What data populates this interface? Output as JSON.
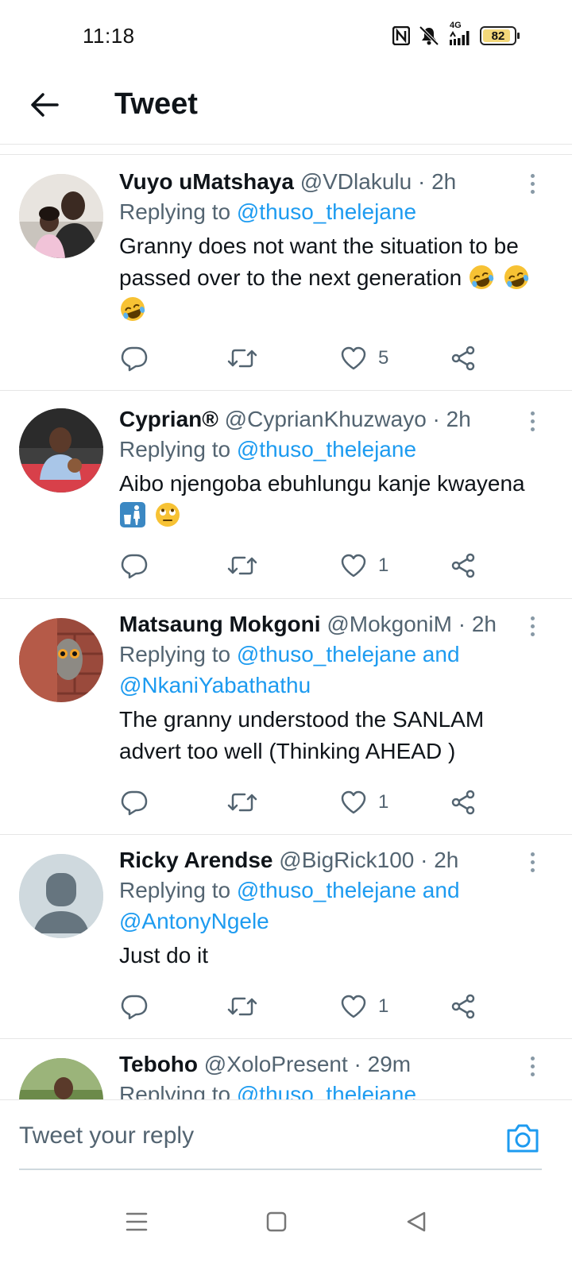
{
  "status_bar": {
    "time": "11:18",
    "network": "4G",
    "battery": "82",
    "battery_level": 0.82,
    "icons": [
      "nfc-icon",
      "mute-icon",
      "signal-icon",
      "battery-icon"
    ]
  },
  "header": {
    "title": "Tweet",
    "back_icon": "arrow-left-icon"
  },
  "tweets": [
    {
      "name": "Vuyo uMatshaya",
      "handle": "@VDlakulu",
      "separator": "·",
      "time": "2h",
      "reply_prefix": "Replying to",
      "reply_to": "@thuso_thelejane",
      "text": "Granny does not want the situation to be passed over to the next generation",
      "emojis": [
        "rofl",
        "rofl",
        "rofl"
      ],
      "likes": "5"
    },
    {
      "name": "Cyprian®",
      "handle": "@CyprianKhuzwayo",
      "separator": "·",
      "time": "2h",
      "reply_prefix": "Replying to",
      "reply_to": "@thuso_thelejane",
      "text": "Aibo njengoba ebuhlungu kanje kwayena",
      "emojis": [
        "litter-bin-sign",
        "eye-roll"
      ],
      "likes": "1"
    },
    {
      "name": "Matsaung Mokgoni",
      "handle": "@MokgoniM",
      "separator": "·",
      "time": "2h",
      "reply_prefix": "Replying to",
      "reply_to": "@thuso_thelejane and",
      "reply_to_2": "@NkaniYabathathu",
      "text": "The granny understood the SANLAM advert too well (Thinking AHEAD )",
      "likes": "1"
    },
    {
      "name": "Ricky Arendse",
      "handle": "@BigRick100",
      "separator": "·",
      "time": "2h",
      "reply_prefix": "Replying to",
      "reply_to": "@thuso_thelejane and",
      "reply_to_2": "@AntonyNgele",
      "text": "Just do it",
      "likes": "1"
    },
    {
      "name": "Teboho",
      "handle": "@XoloPresent",
      "separator": "·",
      "time": "29m",
      "reply_prefix": "Replying to",
      "reply_to": "@thuso_thelejane"
    }
  ],
  "reply_bar": {
    "placeholder": "Tweet your reply",
    "camera_icon": "camera-icon"
  },
  "nav": [
    "menu-icon",
    "home-square-icon",
    "back-triangle-icon"
  ],
  "colors": {
    "accent": "#1d9bf0",
    "secondary_text": "#536471",
    "primary_text": "#0f1419",
    "divider": "#e6e6e6"
  }
}
